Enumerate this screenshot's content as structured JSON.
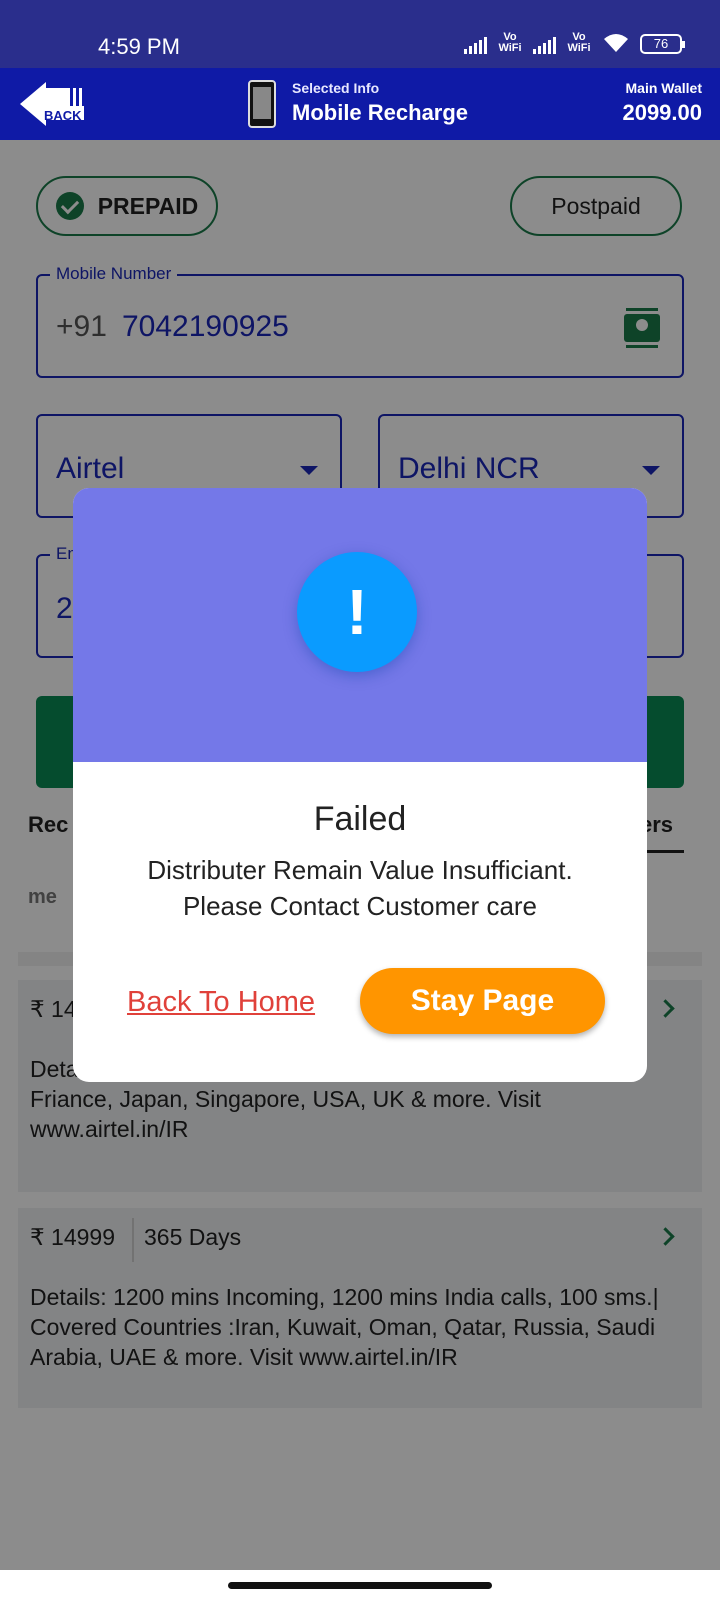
{
  "status_bar": {
    "time": "4:59 PM",
    "vowifi_1": "Vo WiFi",
    "vowifi_2": "Vo WiFi",
    "battery": "76"
  },
  "header": {
    "back_label": "BACK",
    "subtitle": "Selected Info",
    "title": "Mobile Recharge",
    "wallet_label": "Main Wallet",
    "wallet_value": "2099.00"
  },
  "connection_type": {
    "prepaid": "PREPAID",
    "postpaid": "Postpaid",
    "selected": "PREPAID"
  },
  "mobile": {
    "label": "Mobile Number",
    "prefix": "+91",
    "value": "7042190925"
  },
  "operator": {
    "value": "Airtel"
  },
  "circle": {
    "value": "Delhi NCR"
  },
  "amount": {
    "label_fragment": "En",
    "value_fragment": "2"
  },
  "tabs": {
    "left": "Rec",
    "right": "ers"
  },
  "sub_text": "me",
  "plans": [
    {
      "price": "₹ 14",
      "details": "Deta sms.| Covered Countries : Australia, Canada, China, Friance, Japan, Singapore, USA, UK & more. Visit www.airtel.in/IR"
    },
    {
      "price": "₹ 14999",
      "validity": "365 Days",
      "details": "Details: 1200 mins Incoming, 1200 mins India calls, 100 sms.| Covered Countries :Iran, Kuwait, Oman, Qatar, Russia, Saudi Arabia, UAE & more. Visit www.airtel.in/IR"
    }
  ],
  "dialog": {
    "icon": "!",
    "title": "Failed",
    "message_line1": "Distributer Remain Value Insufficiant.",
    "message_line2": "Please Contact Customer care",
    "back_home": "Back To Home",
    "stay_page": "Stay Page"
  },
  "colors": {
    "header": "#0f1aa6",
    "status_bar": "#2a2e8c",
    "dialog_top": "#7478e8",
    "alert_icon": "#0a9bff",
    "stay_button": "#ff9500",
    "link": "#e0413a",
    "accent_green": "#1a7a4a"
  }
}
